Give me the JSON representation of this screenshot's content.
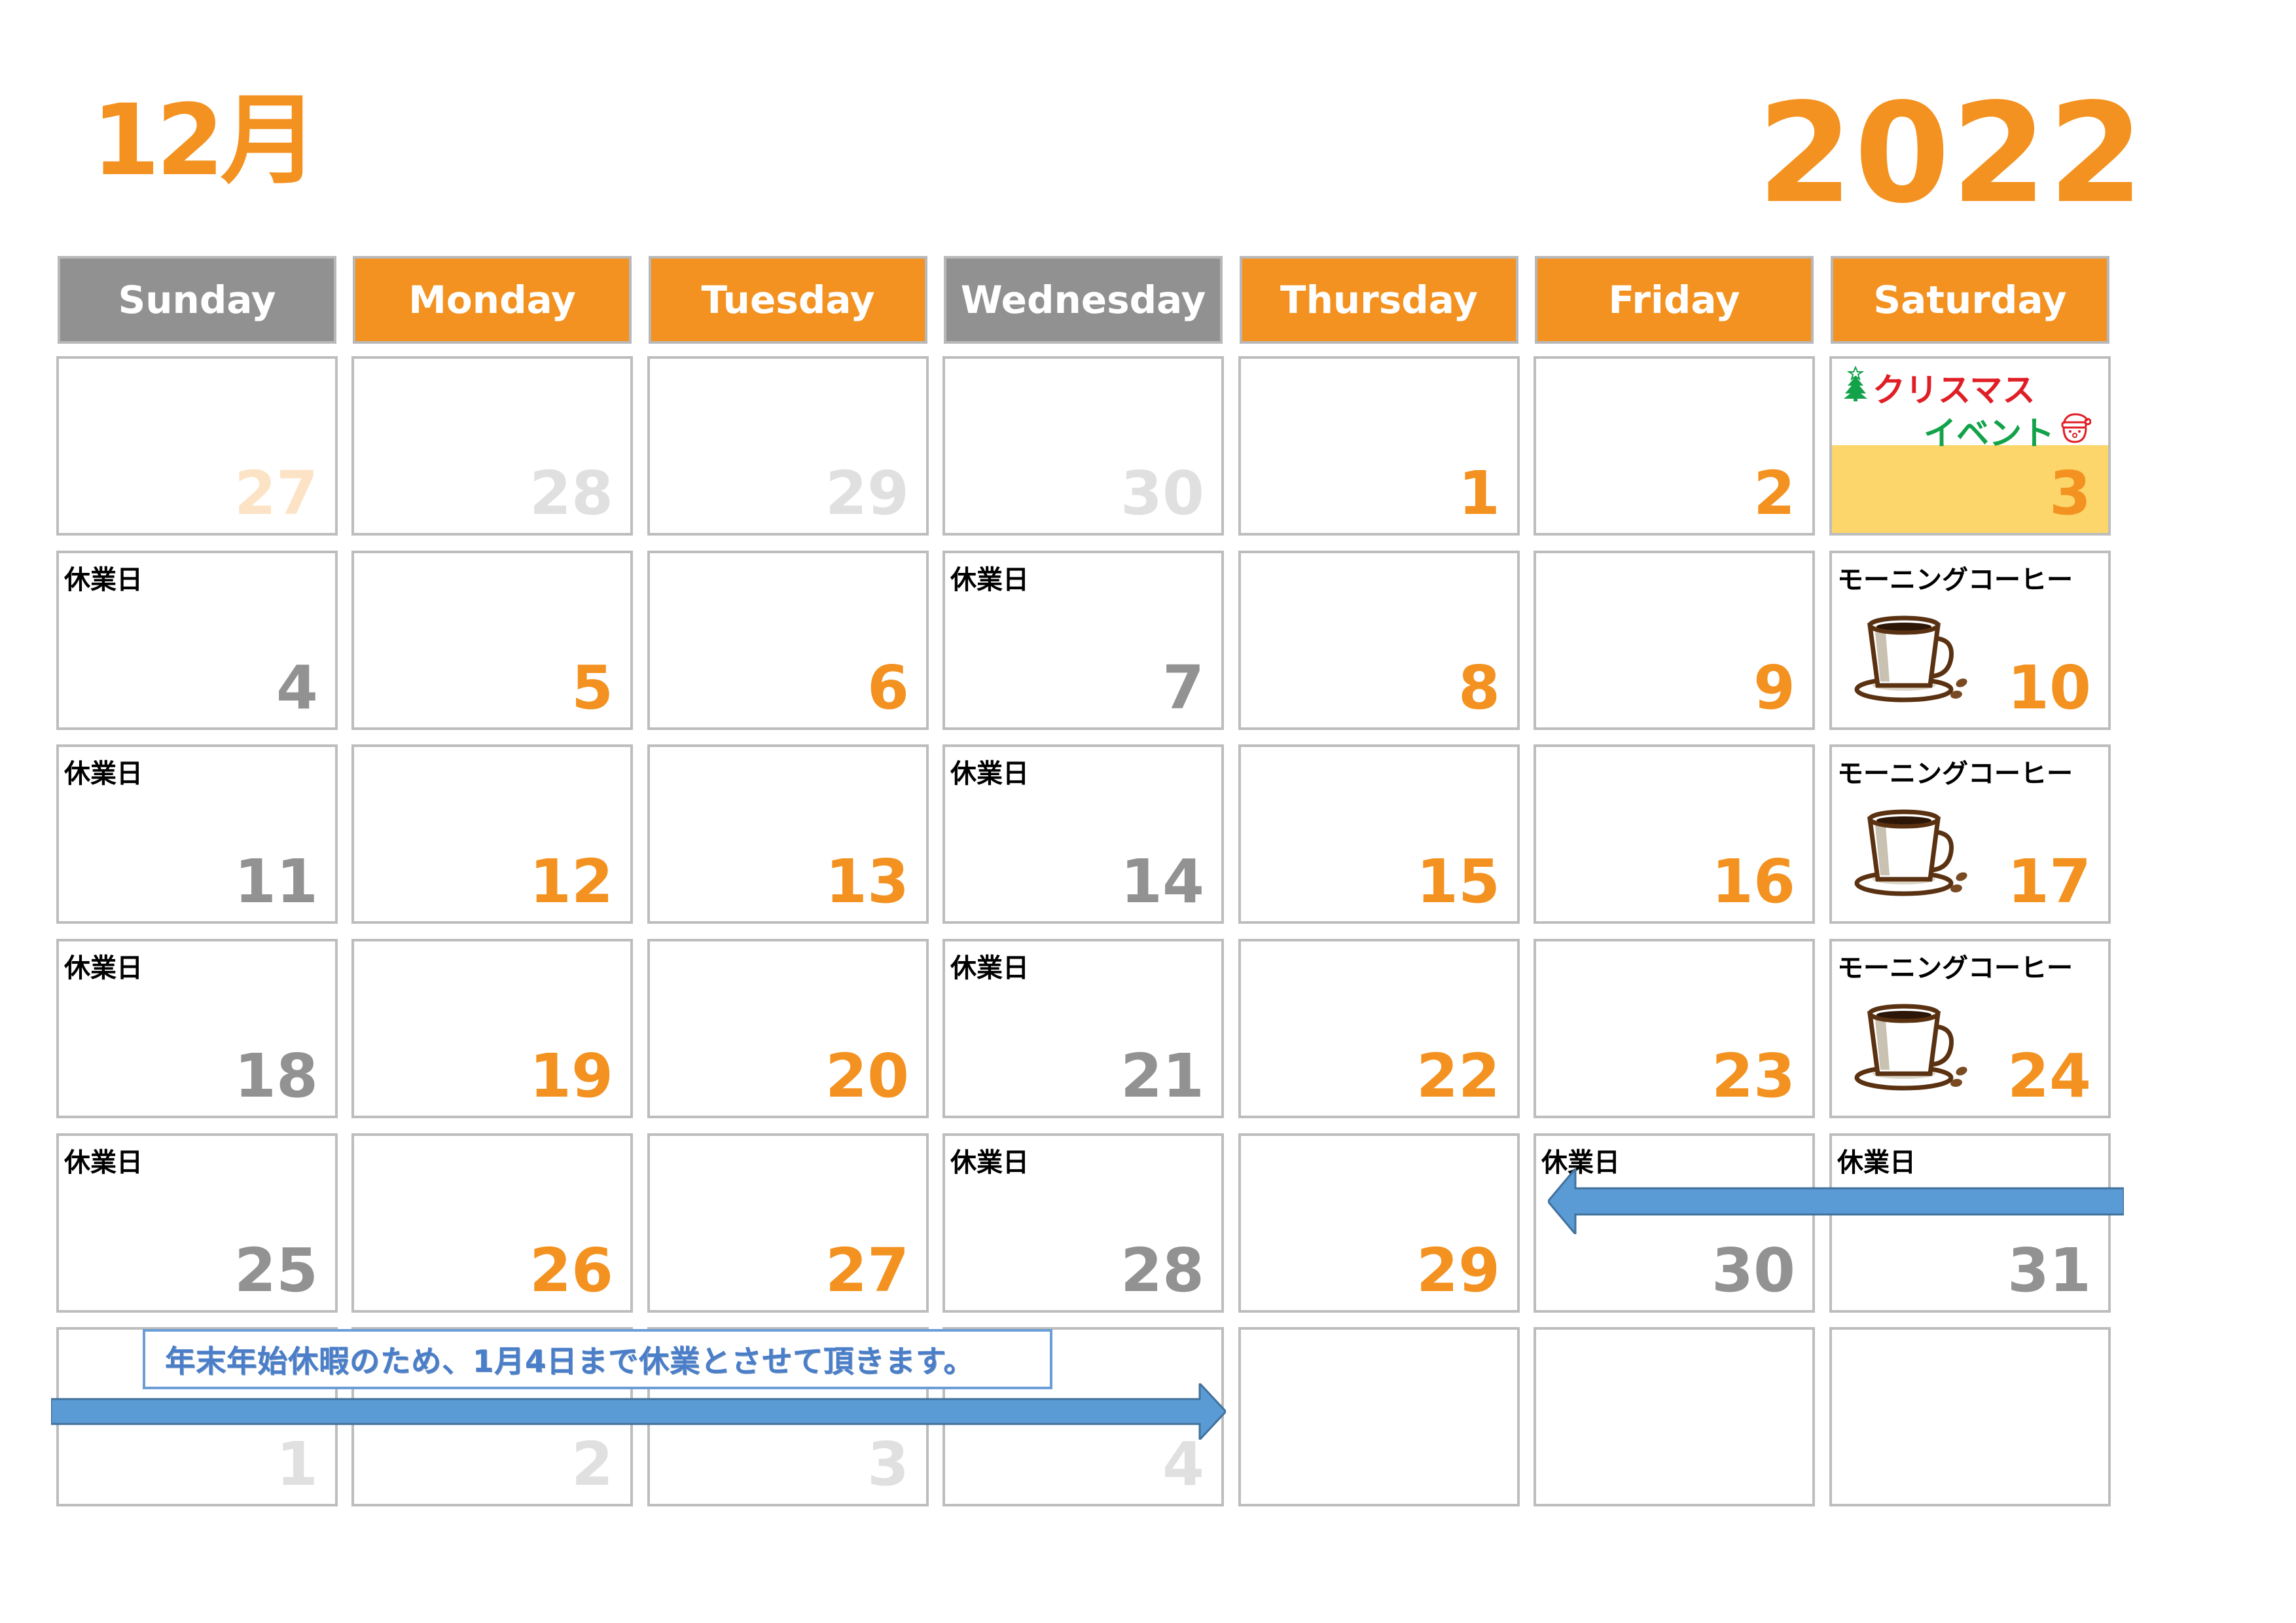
{
  "header": {
    "month": "12月",
    "year": "2022"
  },
  "colors": {
    "accent_orange": "#f39220",
    "header_grey": "#919191",
    "holiday_number_grey": "#929292",
    "outside_month_grey": "#e0e0e0",
    "event_highlight_yellow": "#fcd66a",
    "arrow_blue": "#5b9bd5",
    "christmas_red": "#e01e26",
    "christmas_green": "#12a34a"
  },
  "weekdays": [
    {
      "label": "Sunday",
      "style": "grey"
    },
    {
      "label": "Monday",
      "style": "orange"
    },
    {
      "label": "Tuesday",
      "style": "orange"
    },
    {
      "label": "Wednesday",
      "style": "grey"
    },
    {
      "label": "Thursday",
      "style": "orange"
    },
    {
      "label": "Friday",
      "style": "orange"
    },
    {
      "label": "Saturday",
      "style": "orange"
    }
  ],
  "weeks": [
    [
      {
        "day": "27",
        "tone": "faint-orange"
      },
      {
        "day": "28",
        "tone": "faint"
      },
      {
        "day": "29",
        "tone": "faint"
      },
      {
        "day": "30",
        "tone": "faint"
      },
      {
        "day": "1",
        "tone": "orange"
      },
      {
        "day": "2",
        "tone": "orange"
      },
      {
        "day": "3",
        "tone": "orange",
        "event": "christmas"
      }
    ],
    [
      {
        "day": "4",
        "tone": "grey",
        "note": "休業日"
      },
      {
        "day": "5",
        "tone": "orange"
      },
      {
        "day": "6",
        "tone": "orange"
      },
      {
        "day": "7",
        "tone": "grey",
        "note": "休業日"
      },
      {
        "day": "8",
        "tone": "orange"
      },
      {
        "day": "9",
        "tone": "orange"
      },
      {
        "day": "10",
        "tone": "orange",
        "note": "モーニングコーヒー",
        "icon": "coffee"
      }
    ],
    [
      {
        "day": "11",
        "tone": "grey",
        "note": "休業日"
      },
      {
        "day": "12",
        "tone": "orange"
      },
      {
        "day": "13",
        "tone": "orange"
      },
      {
        "day": "14",
        "tone": "grey",
        "note": "休業日"
      },
      {
        "day": "15",
        "tone": "orange"
      },
      {
        "day": "16",
        "tone": "orange"
      },
      {
        "day": "17",
        "tone": "orange",
        "note": "モーニングコーヒー",
        "icon": "coffee"
      }
    ],
    [
      {
        "day": "18",
        "tone": "grey",
        "note": "休業日"
      },
      {
        "day": "19",
        "tone": "orange"
      },
      {
        "day": "20",
        "tone": "orange"
      },
      {
        "day": "21",
        "tone": "grey",
        "note": "休業日"
      },
      {
        "day": "22",
        "tone": "orange"
      },
      {
        "day": "23",
        "tone": "orange"
      },
      {
        "day": "24",
        "tone": "orange",
        "note": "モーニングコーヒー",
        "icon": "coffee"
      }
    ],
    [
      {
        "day": "25",
        "tone": "grey",
        "note": "休業日"
      },
      {
        "day": "26",
        "tone": "orange"
      },
      {
        "day": "27",
        "tone": "orange"
      },
      {
        "day": "28",
        "tone": "grey",
        "note": "休業日"
      },
      {
        "day": "29",
        "tone": "orange"
      },
      {
        "day": "30",
        "tone": "grey",
        "note": "休業日"
      },
      {
        "day": "31",
        "tone": "grey",
        "note": "休業日"
      }
    ],
    [
      {
        "day": "1",
        "tone": "faint"
      },
      {
        "day": "2",
        "tone": "faint"
      },
      {
        "day": "3",
        "tone": "faint"
      },
      {
        "day": "4",
        "tone": "faint"
      },
      {
        "day": "",
        "tone": "faint"
      },
      {
        "day": "",
        "tone": "faint"
      },
      {
        "day": "",
        "tone": "faint"
      }
    ]
  ],
  "christmas_event": {
    "line1": "クリスマス",
    "line2": "イベント",
    "icons": [
      "christmas-tree-icon",
      "santa-icon"
    ]
  },
  "closure_notice": {
    "text": "年末年始休暇のため、1月4日まで休業とさせて頂きます。"
  }
}
